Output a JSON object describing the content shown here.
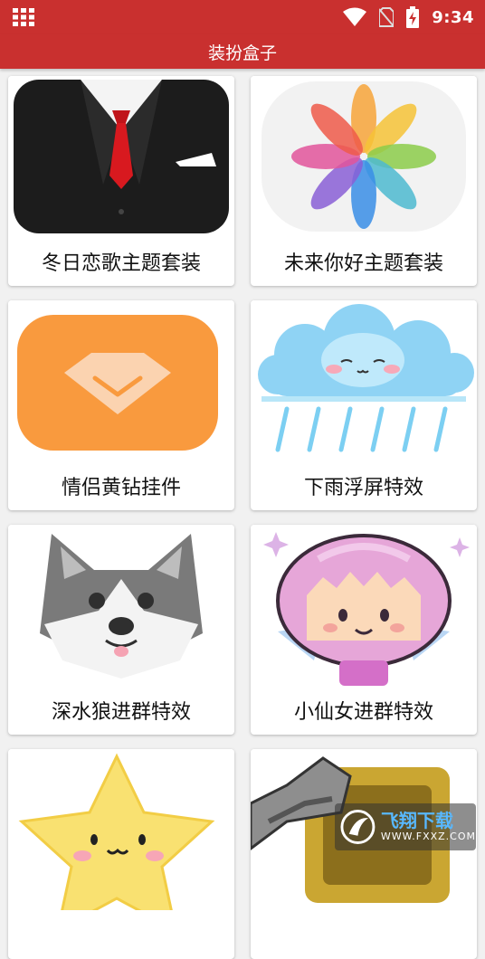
{
  "status_bar": {
    "time": "9:34",
    "icons": [
      "grid-icon",
      "wifi-icon",
      "no-sim-icon",
      "battery-charging-icon"
    ]
  },
  "title_bar": {
    "title": "装扮盒子"
  },
  "items": [
    {
      "label": "冬日恋歌主题套装",
      "icon": "tuxedo-icon"
    },
    {
      "label": "未来你好主题套装",
      "icon": "petal-flower-icon"
    },
    {
      "label": "情侣黄钻挂件",
      "icon": "diamond-badge-icon"
    },
    {
      "label": "下雨浮屏特效",
      "icon": "rain-cloud-icon"
    },
    {
      "label": "深水狼进群特效",
      "icon": "husky-icon"
    },
    {
      "label": "小仙女进群特效",
      "icon": "fairy-icon"
    },
    {
      "label": "",
      "icon": "star-face-icon"
    },
    {
      "label": "",
      "icon": "robot-arm-icon"
    }
  ],
  "watermark": {
    "title": "飞翔下载",
    "url": "WWW.FXXZ.COM"
  },
  "colors": {
    "primary": "#c9302f",
    "background": "#f1f1f1",
    "card": "#ffffff"
  }
}
